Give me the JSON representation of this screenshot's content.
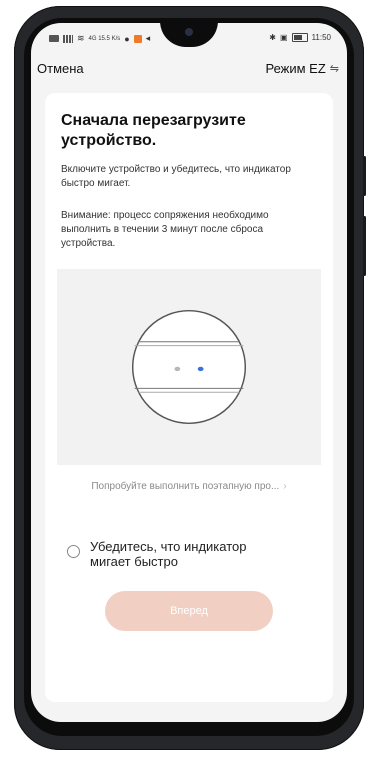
{
  "status_bar": {
    "left_text": "4G 15.5 K/s",
    "right_text": "11:50"
  },
  "nav": {
    "cancel_label": "Отмена",
    "mode_label": "Режим EZ",
    "mode_icon": "swap-arrows-icon"
  },
  "content": {
    "title": "Сначала перезагрузите устройство.",
    "instruction": "Включите устройство и убедитесь, что индикатор быстро мигает.",
    "warning": "Внимание: процесс сопряжения необходимо выполнить в течении 3 минут после сброса устройства.",
    "hint_link": "Попробуйте выполнить поэтапную про...",
    "confirm_label": "Убедитесь, что индикатор мигает быстро",
    "next_button": "Вперед"
  },
  "colors": {
    "next_button_bg": "#f1cfc3",
    "led_grey": "#b8b8bc",
    "led_blue": "#3a73d9",
    "phone_frame": "#26272b"
  }
}
